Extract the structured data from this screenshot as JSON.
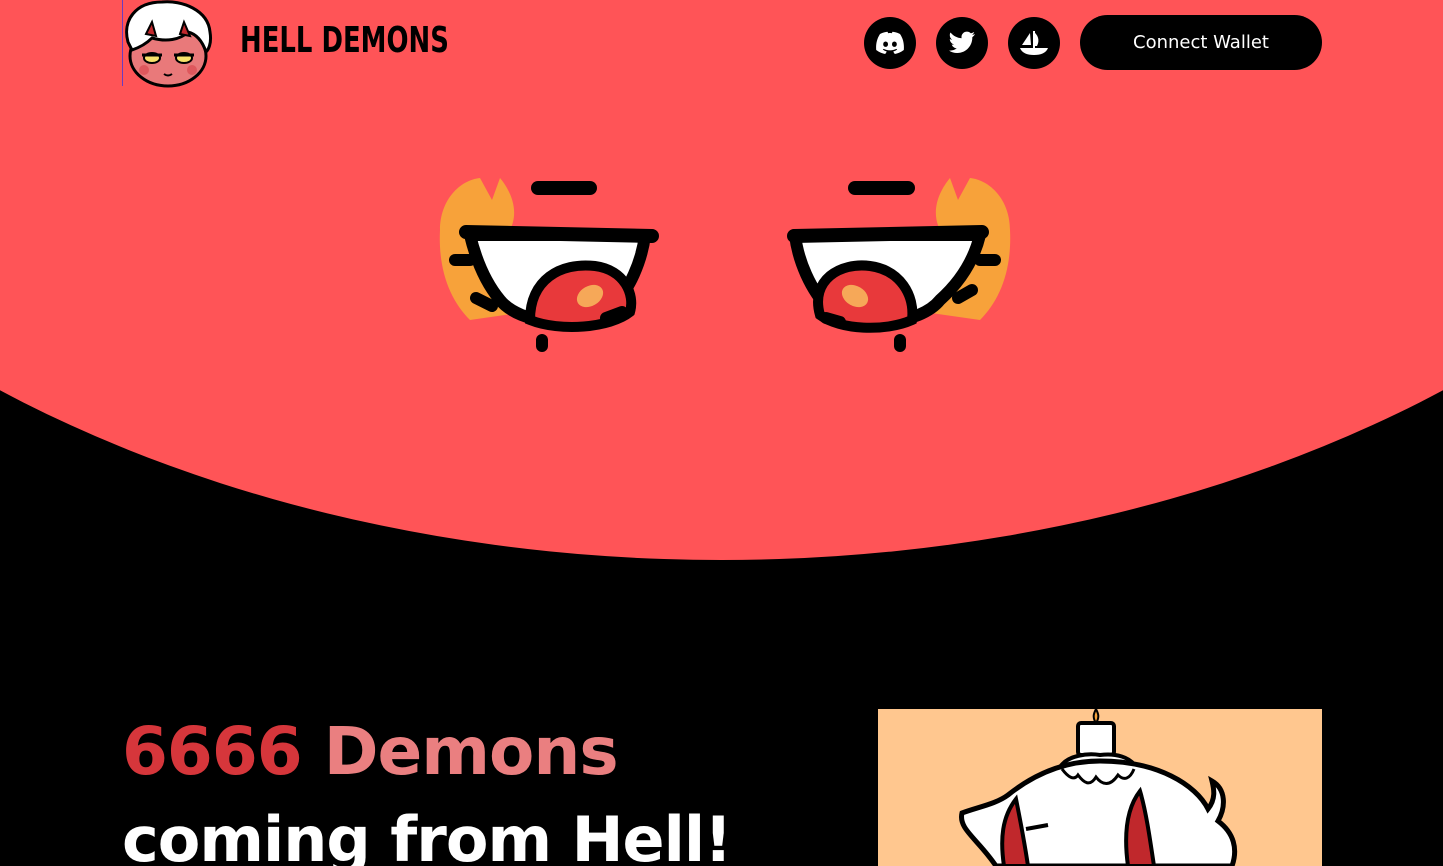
{
  "header": {
    "brand": "HELL DEMONS",
    "connect_label": "Connect Wallet",
    "socials": [
      {
        "name": "discord-icon"
      },
      {
        "name": "twitter-icon"
      },
      {
        "name": "opensea-icon"
      }
    ]
  },
  "hero": {
    "count": "6666",
    "count_word": "Demons",
    "subline": "coming from Hell!"
  },
  "colors": {
    "hero_bg": "#ff5457",
    "page_bg": "#000000",
    "accent_dark": "#d6363b",
    "accent_light": "#ea7f80",
    "preview_bg": "#ffc78f"
  }
}
